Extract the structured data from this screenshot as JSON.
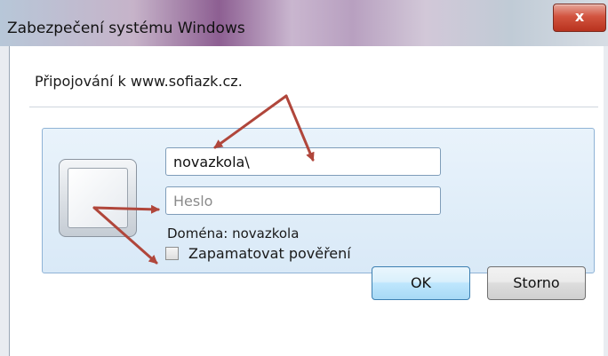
{
  "window": {
    "title": "Zabezpečení systému Windows",
    "close_glyph": "x"
  },
  "dialog": {
    "connecting_text": "Připojování k www.sofiazk.cz.",
    "username": {
      "value": "novazkola\\"
    },
    "password": {
      "placeholder": "Heslo"
    },
    "domain_text": "Doména: novazkola",
    "remember_label": "Zapamatovat pověření",
    "remember_checked": false
  },
  "buttons": {
    "ok_label": "OK",
    "cancel_label": "Storno"
  },
  "annotation": {
    "arrow_color": "#b0463b"
  }
}
